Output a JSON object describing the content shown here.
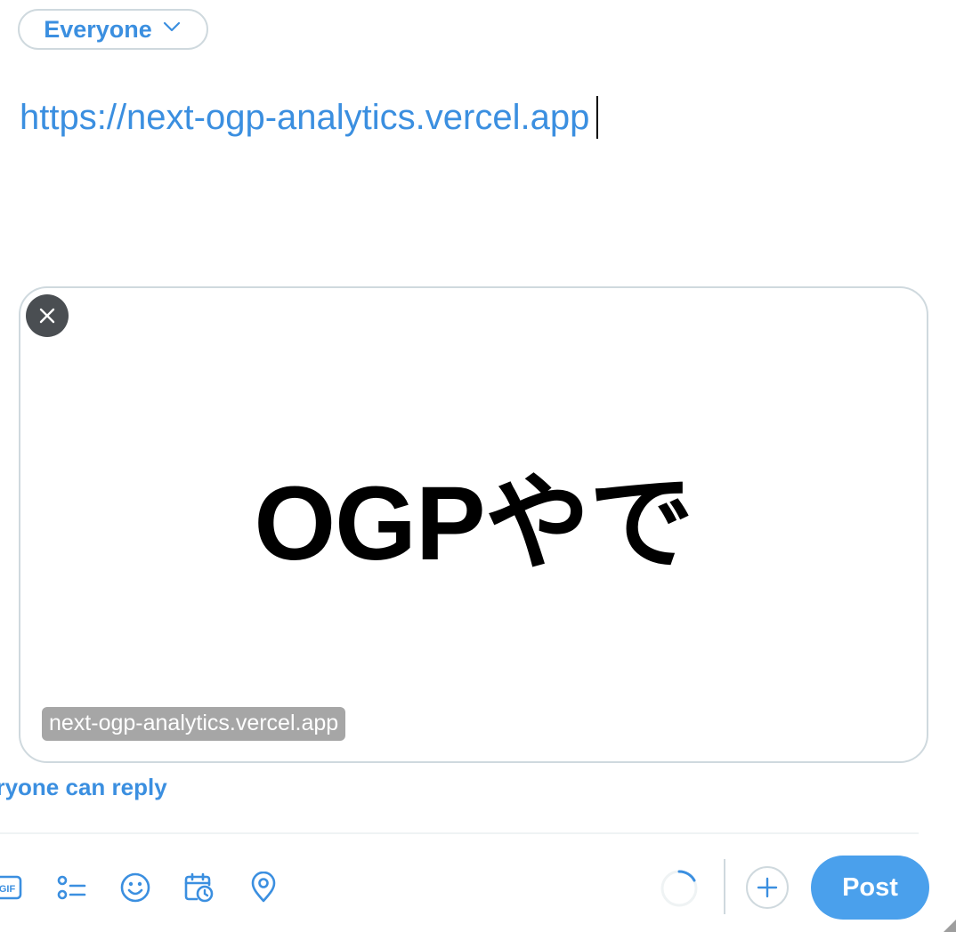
{
  "audience": {
    "label": "Everyone",
    "icon": "chevron-down-icon"
  },
  "composer": {
    "text": "https://next-ogp-analytics.vercel.app"
  },
  "link_card": {
    "image_text": "OGPやで",
    "domain": "next-ogp-analytics.vercel.app",
    "remove_icon": "close-icon"
  },
  "reply_setting": {
    "label": "eryone can reply"
  },
  "toolbar": {
    "icons": [
      "gif-icon",
      "poll-icon",
      "emoji-icon",
      "schedule-icon",
      "location-icon"
    ],
    "gif_label": "GIF",
    "add_icon": "plus-icon",
    "post_label": "Post"
  },
  "colors": {
    "accent": "#3b8fe0",
    "post_button": "#4aa0ec",
    "border": "#cfd9de",
    "remove_button": "#4a4e52",
    "domain_badge": "#a6a6a6"
  }
}
